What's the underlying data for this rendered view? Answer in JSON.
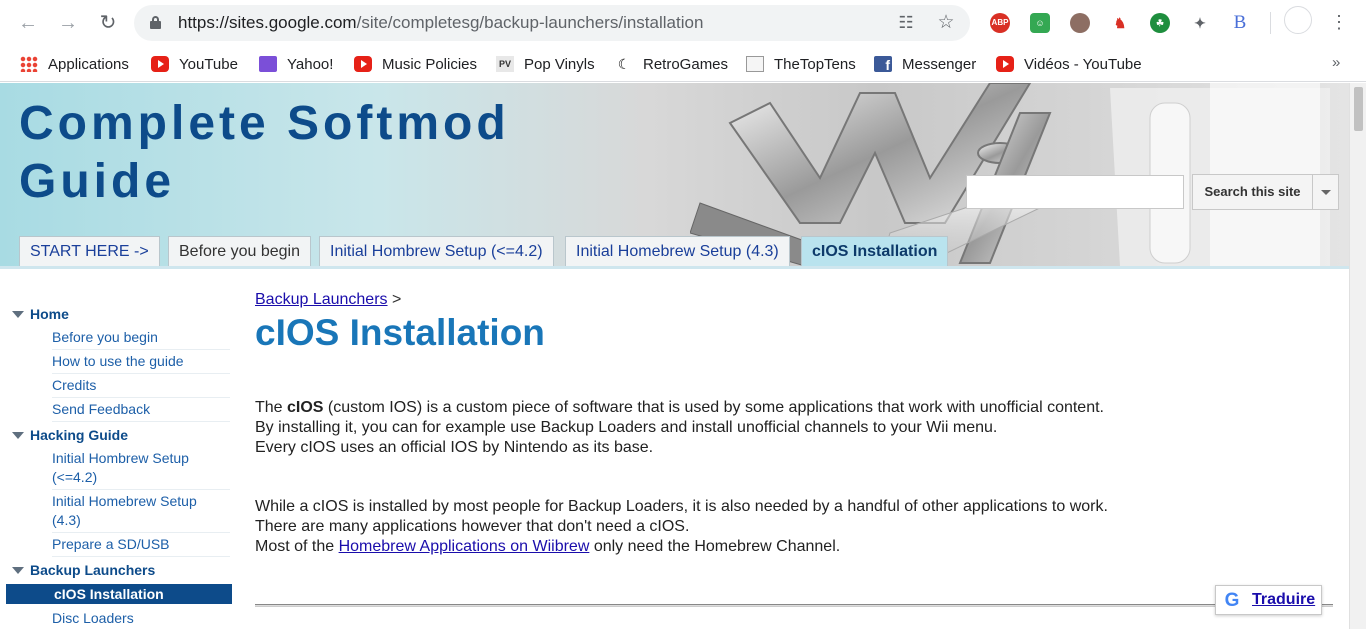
{
  "browser": {
    "url_host": "https://sites.google.com",
    "url_path": "/site/completesg/backup-launchers/installation",
    "extensions": [
      "ABP",
      "",
      "",
      "",
      "",
      "",
      "B"
    ],
    "bookmarks": [
      {
        "label": "Applications",
        "icon": "apps-icon"
      },
      {
        "label": "YouTube",
        "icon": "youtube-icon"
      },
      {
        "label": "Yahoo!",
        "icon": "yahoo-mail-icon"
      },
      {
        "label": "Music Policies",
        "icon": "youtube-icon"
      },
      {
        "label": "Pop Vinyls",
        "icon": "pop-vinyls-icon"
      },
      {
        "label": "RetroGames",
        "icon": "space-invader-icon"
      },
      {
        "label": "TheTopTens",
        "icon": "thetoptens-icon"
      },
      {
        "label": "Messenger",
        "icon": "facebook-icon"
      },
      {
        "label": "Vidéos - YouTube",
        "icon": "youtube-icon"
      }
    ],
    "more_bookmarks": "»"
  },
  "site": {
    "title_line1": "Complete Softmod",
    "title_line2": "Guide",
    "search_button": "Search this site",
    "tabs": [
      {
        "label": "START HERE ->"
      },
      {
        "label": "Before you begin"
      },
      {
        "label": "Initial Hombrew Setup (<=4.2)"
      },
      {
        "label": "Initial Homebrew Setup (4.3)"
      },
      {
        "label": "cIOS Installation"
      }
    ]
  },
  "sidebar": {
    "sections": [
      {
        "label": "Home"
      },
      {
        "label": "Hacking Guide"
      },
      {
        "label": "Backup Launchers"
      }
    ],
    "home_items": [
      "Before you begin",
      "How to use the guide",
      "Credits",
      "Send Feedback"
    ],
    "hacking_items": [
      "Initial Hombrew Setup",
      "(<=4.2)",
      "Initial Homebrew Setup",
      "(4.3)",
      "Prepare a SD/USB"
    ],
    "backup_items": [
      "cIOS Installation",
      "Disc Loaders"
    ]
  },
  "main": {
    "breadcrumb_link": "Backup Launchers",
    "breadcrumb_sep": " >",
    "title": "cIOS Installation",
    "p1_pre": "The ",
    "p1_bold": "cIOS",
    "p1_post": " (custom IOS) is a custom piece of software that is used by some applications that work with unofficial content.",
    "p1_line2": "By installing it, you can for example use Backup Loaders and install unofficial channels to your Wii menu.",
    "p1_line3": "Every cIOS uses an official IOS by Nintendo as its base.",
    "p2_line1": "While a cIOS is installed by most people for Backup Loaders, it is also needed by a handful of other applications to work.",
    "p2_line2": "There are many applications however that don't need a cIOS.",
    "p2_line3_pre": "Most of the ",
    "p2_line3_link": "Homebrew Applications on Wiibrew",
    "p2_line3_post": " only need the Homebrew Channel."
  },
  "translate": {
    "logo": "G",
    "label": "Traduire"
  }
}
